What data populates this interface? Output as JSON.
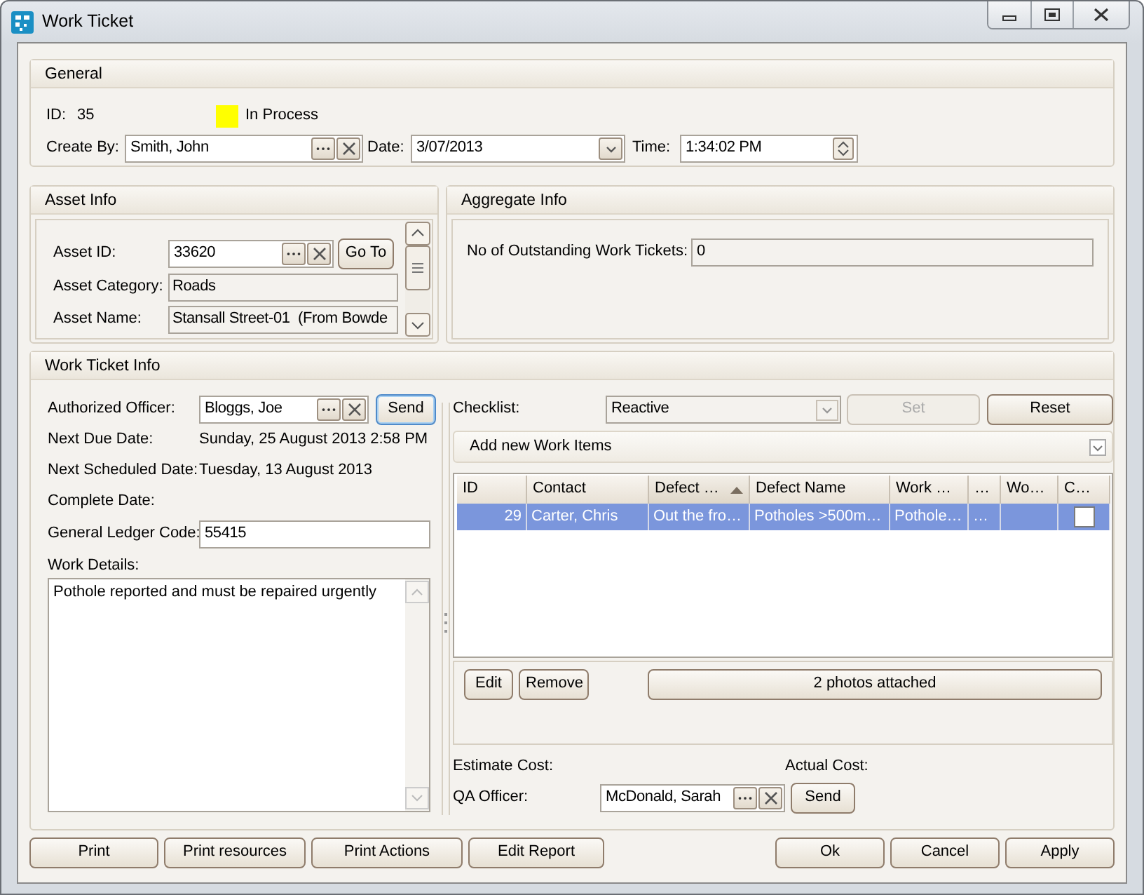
{
  "window": {
    "title": "Work Ticket"
  },
  "general": {
    "title": "General",
    "id_label": "ID:",
    "id_value": "35",
    "status": {
      "color": "#ffff00",
      "text": "In Process"
    },
    "create_by": {
      "label": "Create By:",
      "value": "Smith, John"
    },
    "date": {
      "label": "Date:",
      "value": "3/07/2013"
    },
    "time": {
      "label": "Time:",
      "value": "1:34:02 PM"
    }
  },
  "asset_info": {
    "title": "Asset Info",
    "asset_id": {
      "label": "Asset ID:",
      "value": "33620"
    },
    "goto_button": "Go To",
    "category": {
      "label": "Asset Category:",
      "value": "Roads"
    },
    "name": {
      "label": "Asset Name:",
      "value": "Stansall Street-01  (From Bowde"
    }
  },
  "aggregate_info": {
    "title": "Aggregate Info",
    "outstanding": {
      "label": "No of Outstanding Work Tickets:",
      "value": "0"
    }
  },
  "work_ticket_info": {
    "title": "Work Ticket Info",
    "authorized_officer": {
      "label": "Authorized Officer:",
      "value": "Bloggs, Joe"
    },
    "send_button": "Send",
    "dates": [
      {
        "label": "Next Due Date:",
        "value": "Sunday, 25 August 2013 2:58 PM"
      },
      {
        "label": "Next Scheduled Date:",
        "value": "Tuesday, 13 August 2013"
      },
      {
        "label": "Complete Date:"
      }
    ],
    "ledger": {
      "label": "General Ledger Code:",
      "value": "55415"
    },
    "work_details": {
      "label": "Work Details:",
      "value": "Pothole reported and must be repaired urgently"
    },
    "checklist": {
      "label": "Checklist:",
      "value": "Reactive"
    },
    "set_button": {
      "label": "Set",
      "disabled": true
    },
    "reset_button": "Reset",
    "add_items": "Add new Work Items",
    "table": {
      "columns": [
        {
          "label": "ID",
          "sorted": false
        },
        {
          "label": "Contact",
          "sorted": false
        },
        {
          "label": "Defect …",
          "sorted": true
        },
        {
          "label": "Defect Name",
          "sorted": false
        },
        {
          "label": "Work …",
          "sorted": false
        },
        {
          "label": "…",
          "sorted": false
        },
        {
          "label": "Wo…",
          "sorted": false
        },
        {
          "label": "C…",
          "sorted": false
        }
      ],
      "rows": [
        {
          "selected": true,
          "checked": false,
          "cells": [
            "29",
            "Carter, Chris",
            "Out the fro…",
            "Potholes >500m…",
            "Pothole…",
            "…"
          ]
        }
      ]
    },
    "item_buttons": [
      "Edit",
      "Remove"
    ],
    "photos_button": "2 photos attached",
    "estimate_cost": {
      "label": "Estimate Cost:"
    },
    "actual_cost": {
      "label": "Actual Cost:"
    },
    "qa_officer": {
      "label": "QA Officer:",
      "value": "McDonald, Sarah"
    },
    "qa_send_button": "Send"
  },
  "footer": {
    "left_buttons": [
      "Print",
      "Print resources",
      "Print Actions",
      "Edit Report"
    ],
    "right_buttons": [
      "Ok",
      "Cancel",
      "Apply"
    ]
  }
}
